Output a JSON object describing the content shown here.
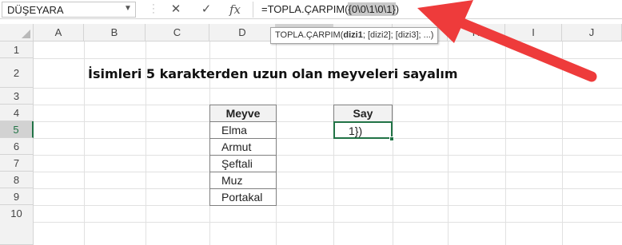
{
  "name_box": {
    "value": "DÜŞEYARA"
  },
  "formula_bar": {
    "cancel_icon": "✕",
    "enter_icon": "✓",
    "fx_icon": "fx",
    "formula_prefix": "=TOPLA.ÇARPIM(",
    "formula_selected": "{0\\0\\1\\0\\1}",
    "formula_suffix": ")"
  },
  "tooltip": {
    "func": "TOPLA.ÇARPIM(",
    "arg1": "dizi1",
    "rest": "; [dizi2]; [dizi3]; ...)"
  },
  "columns": [
    "A",
    "B",
    "C",
    "D",
    "E",
    "F",
    "G",
    "H",
    "I",
    "J"
  ],
  "rows": [
    "1",
    "2",
    "3",
    "4",
    "5",
    "6",
    "7",
    "8",
    "9",
    "10"
  ],
  "title": "İsimleri 5 karakterden uzun olan meyveleri sayalım",
  "fruit_table": {
    "header": "Meyve",
    "items": [
      "Elma",
      "Armut",
      "Şeftali",
      "Muz",
      "Portakal"
    ]
  },
  "count_table": {
    "header": "Say",
    "value": "1})"
  },
  "colors": {
    "accent": "#217346",
    "arrow": "#ee3b3b"
  }
}
